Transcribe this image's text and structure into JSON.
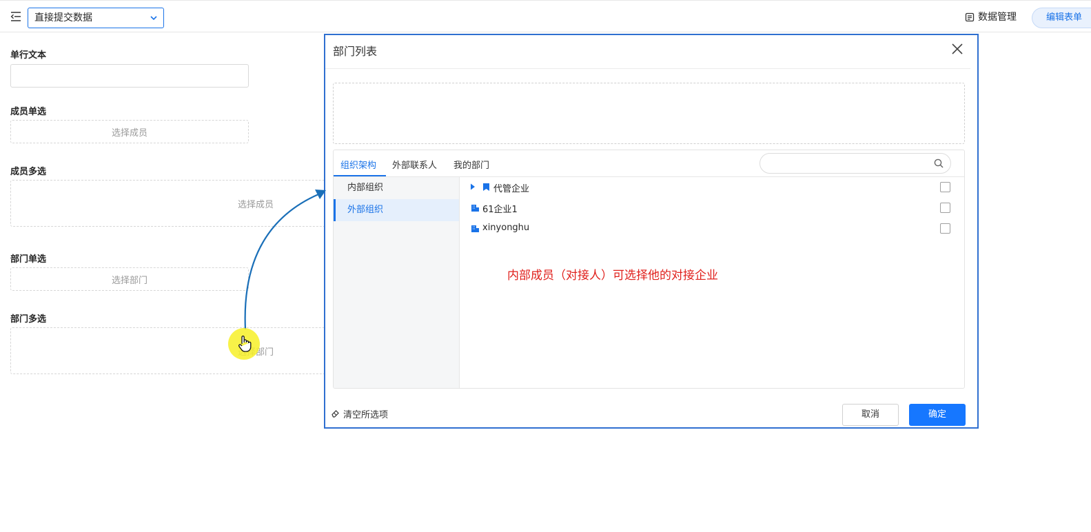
{
  "topbar": {
    "view_select_value": "直接提交数据",
    "data_management_label": "数据管理",
    "edit_form_label": "编辑表单"
  },
  "form": {
    "fields": [
      {
        "label": "单行文本"
      },
      {
        "label": "成员单选",
        "placeholder": "选择成员"
      },
      {
        "label": "成员多选",
        "placeholder": "选择成员"
      },
      {
        "label": "部门单选",
        "placeholder": "选择部门"
      },
      {
        "label": "部门多选",
        "placeholder": "选择部门"
      }
    ]
  },
  "dialog": {
    "title": "部门列表",
    "tabs": [
      "组织架构",
      "外部联系人",
      "我的部门"
    ],
    "active_tab": "组织架构",
    "sidebar": [
      "内部组织",
      "外部组织"
    ],
    "active_sidebar": "外部组织",
    "tree": [
      {
        "label": "代管企业",
        "icon": "bookmark-icon",
        "expandable": true,
        "checked": false
      },
      {
        "label": "61企业1",
        "icon": "building-icon",
        "expandable": false,
        "checked": false
      },
      {
        "label": "xinyonghu",
        "icon": "building-icon",
        "expandable": false,
        "checked": false
      }
    ],
    "annotation": "内部成员（对接人）可选择他的对接企业",
    "clear_all_label": "清空所选项",
    "cancel_label": "取消",
    "confirm_label": "确定"
  },
  "colors": {
    "primary": "#1677ff",
    "annotation": "#e0201c",
    "arrow": "#1a6fb8",
    "cursor_highlight": "#f7f028"
  }
}
